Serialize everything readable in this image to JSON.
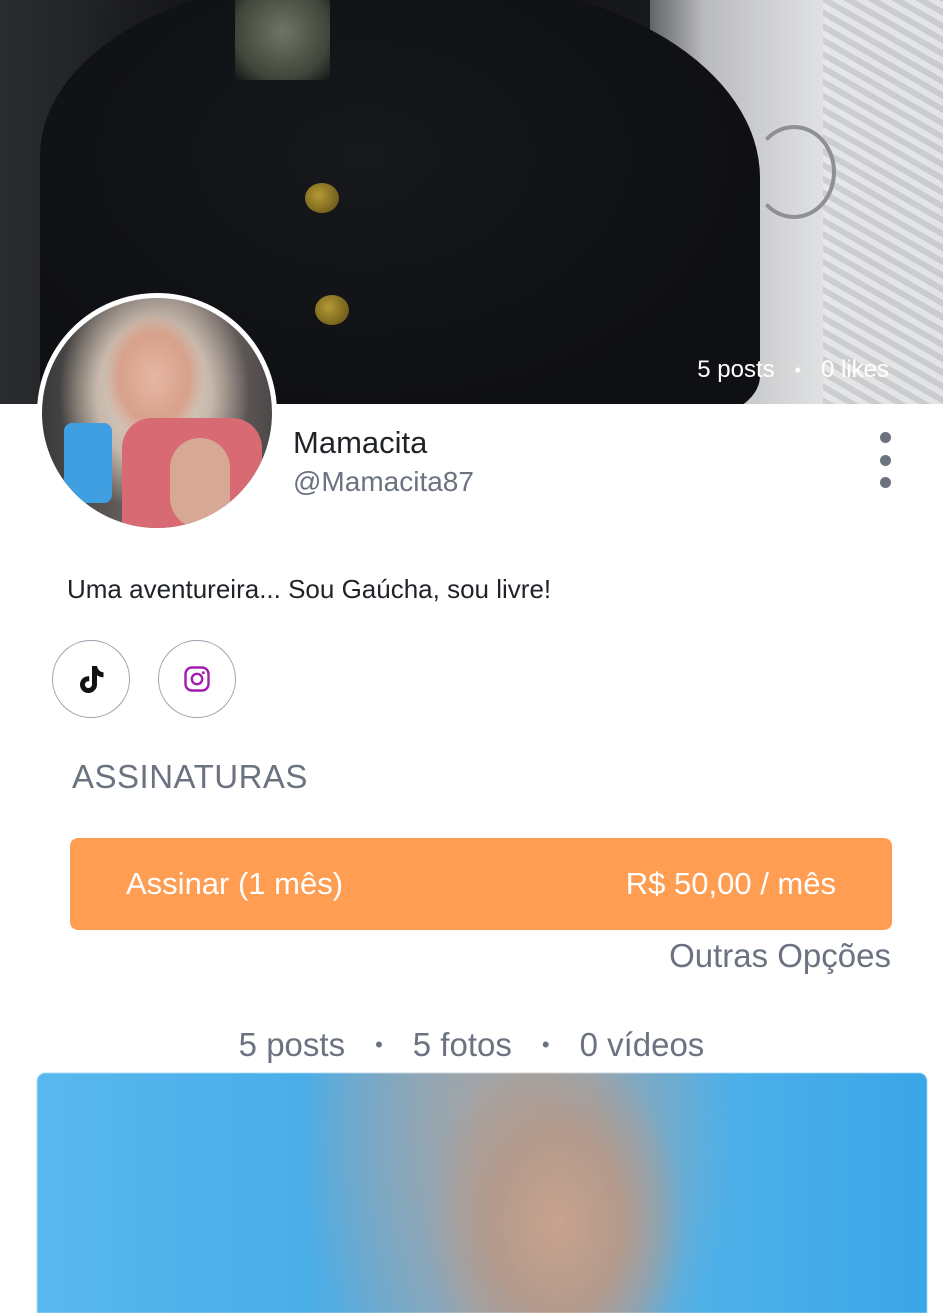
{
  "profile": {
    "name": "Mamacita",
    "handle": "@Mamacita87",
    "bio": "Uma aventureira... Sou Gaúcha, sou livre!"
  },
  "cover_stats": {
    "posts": "5 posts",
    "likes": "0 likes",
    "separator": "•"
  },
  "social": {
    "tiktok_icon": "tiktok-icon",
    "instagram_icon": "instagram-icon"
  },
  "subscriptions": {
    "title": "ASSINATURAS",
    "button_label": "Assinar (1 mês)",
    "button_price": "R$ 50,00 / mês",
    "other_options": "Outras Opções"
  },
  "content_stats": {
    "posts": "5 posts",
    "photos": "5 fotos",
    "videos": "0 vídeos",
    "separator": "•"
  },
  "colors": {
    "accent_orange": "#ff9d52",
    "muted_text": "#6b7280",
    "instagram_purple": "#a21caf"
  }
}
